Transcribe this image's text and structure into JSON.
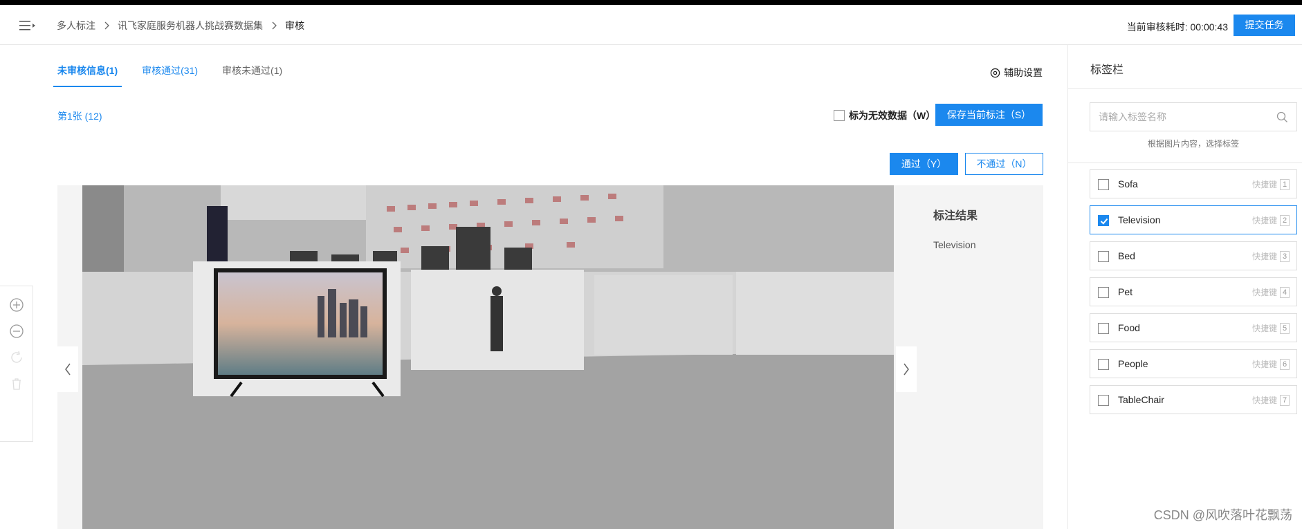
{
  "header": {
    "breadcrumb": [
      "多人标注",
      "讯飞家庭服务机器人挑战赛数据集",
      "审核"
    ],
    "timer_label": "当前审核耗时:",
    "timer_value": "00:00:43",
    "submit_label": "提交任务"
  },
  "tabs": [
    {
      "label": "未审核信息(1)",
      "active": true
    },
    {
      "label": "审核通过(31)"
    },
    {
      "label": "审核未通过(1)"
    }
  ],
  "assist_label": "辅助设置",
  "page_index": "第1张 (12)",
  "invalid_label": "标为无效数据（W）",
  "save_label": "保存当前标注（S）",
  "pass_label": "通过（Y）",
  "fail_label": "不通过（N）",
  "result": {
    "title": "标注结果",
    "items": [
      "Television"
    ]
  },
  "sidebar": {
    "title": "标签栏",
    "search_placeholder": "请输入标签名称",
    "hint": "根据图片内容，选择标签",
    "shortcut_label": "快捷键",
    "labels": [
      {
        "name": "Sofa",
        "key": "1",
        "checked": false
      },
      {
        "name": "Television",
        "key": "2",
        "checked": true
      },
      {
        "name": "Bed",
        "key": "3",
        "checked": false
      },
      {
        "name": "Pet",
        "key": "4",
        "checked": false
      },
      {
        "name": "Food",
        "key": "5",
        "checked": false
      },
      {
        "name": "People",
        "key": "6",
        "checked": false
      },
      {
        "name": "TableChair",
        "key": "7",
        "checked": false
      }
    ]
  },
  "watermark": "CSDN @风吹落叶花飘荡",
  "colors": {
    "accent": "#1b88ee"
  }
}
